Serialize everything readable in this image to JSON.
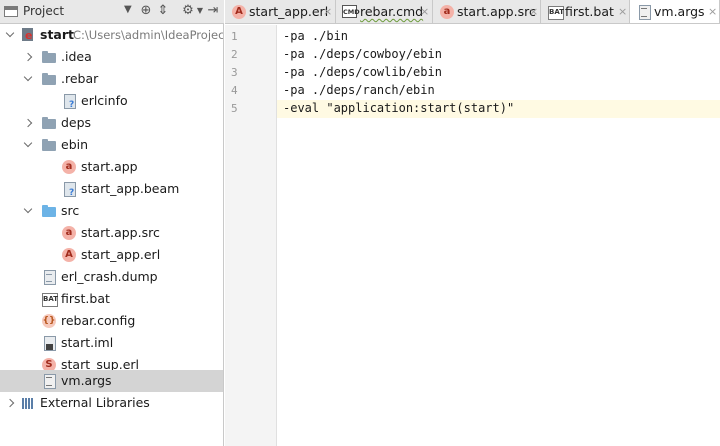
{
  "project_panel": {
    "title": "Project",
    "header_buttons": [
      "target-icon",
      "collapse-icon",
      "gear-icon",
      "hide-icon"
    ],
    "tree": [
      {
        "label": "start",
        "path": "C:\\Users\\admin\\IdeaProjects",
        "icon": "module-icon"
      },
      {
        "label": ".idea",
        "icon": "folder-icon"
      },
      {
        "label": ".rebar",
        "icon": "folder-icon"
      },
      {
        "label": "erlcinfo",
        "icon": "unknown-file-icon"
      },
      {
        "label": "deps",
        "icon": "folder-icon"
      },
      {
        "label": "ebin",
        "icon": "folder-icon"
      },
      {
        "label": "start.app",
        "icon": "app-file-icon",
        "glyph": "a"
      },
      {
        "label": "start_app.beam",
        "icon": "unknown-file-icon"
      },
      {
        "label": "src",
        "icon": "source-folder-icon"
      },
      {
        "label": "start.app.src",
        "icon": "app-file-icon",
        "glyph": "a"
      },
      {
        "label": "start_app.erl",
        "icon": "erlang-application-icon",
        "glyph": "A"
      },
      {
        "label": "erl_crash.dump",
        "icon": "text-file-icon"
      },
      {
        "label": "first.bat",
        "icon": "bat-file-icon",
        "glyph": "BAT"
      },
      {
        "label": "rebar.config",
        "icon": "config-file-icon",
        "glyph": "{}"
      },
      {
        "label": "start.iml",
        "icon": "iml-file-icon"
      },
      {
        "label": "start_sup.erl",
        "icon": "erlang-supervisor-icon",
        "glyph": "S"
      },
      {
        "label": "vm.args",
        "icon": "text-file-icon"
      },
      {
        "label": "External Libraries",
        "icon": "libraries-icon"
      }
    ]
  },
  "tabs": [
    {
      "label": "start_app.erl",
      "icon": "erlang-application-icon",
      "glyph": "A",
      "close": "×"
    },
    {
      "label": "rebar.cmd",
      "icon": "cmd-file-icon",
      "glyph": "CMD",
      "close": "×"
    },
    {
      "label": "start.app.src",
      "icon": "app-file-icon",
      "glyph": "a",
      "close": "×"
    },
    {
      "label": "first.bat",
      "icon": "bat-file-icon",
      "glyph": "BAT",
      "close": "×"
    },
    {
      "label": "vm.args",
      "icon": "text-file-icon",
      "close": "×",
      "active": true
    }
  ],
  "editor": {
    "current_line": 5,
    "lines": [
      {
        "num": "1",
        "text": "-pa ./bin"
      },
      {
        "num": "2",
        "text": "-pa ./deps/cowboy/ebin"
      },
      {
        "num": "3",
        "text": "-pa ./deps/cowlib/ebin"
      },
      {
        "num": "4",
        "text": "-pa ./deps/ranch/ebin"
      },
      {
        "num": "5",
        "text": "-eval \"application:start(start)\""
      }
    ]
  },
  "colors": {
    "selection": "#d4d4d4",
    "current_line": "#fffae3",
    "erlang_icon": "#f4b2a8",
    "folder": "#8fa2b3",
    "source_folder": "#6cb3e6"
  }
}
